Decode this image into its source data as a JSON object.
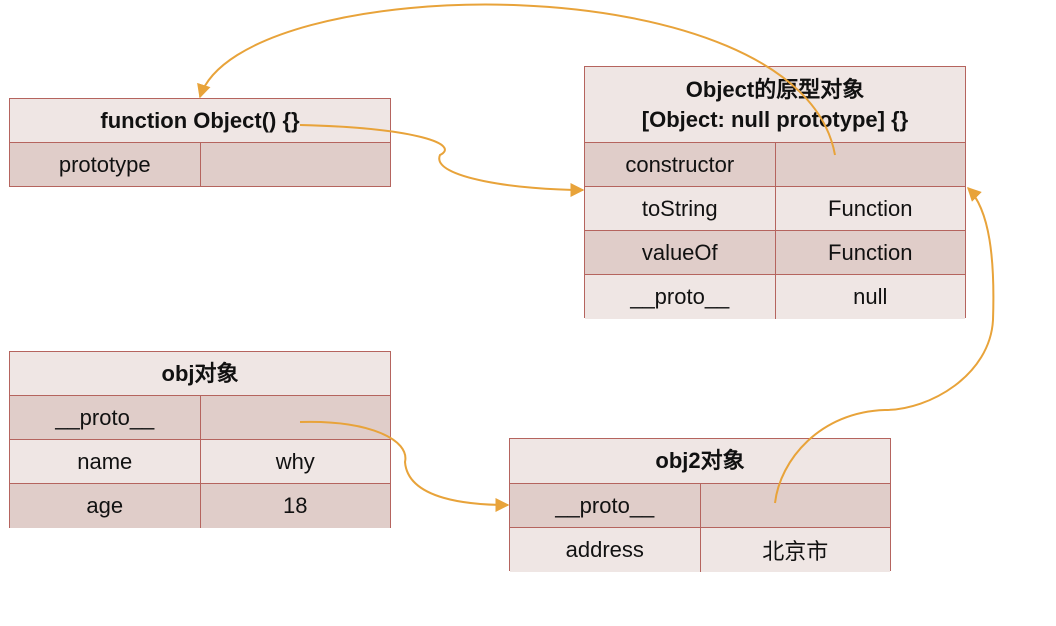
{
  "tables": {
    "object_fn": {
      "header": [
        "function Object() {}"
      ],
      "rows": [
        [
          "prototype",
          ""
        ]
      ]
    },
    "object_proto": {
      "header": [
        "Object的原型对象",
        "[Object: null prototype] {}"
      ],
      "rows": [
        [
          "constructor",
          ""
        ],
        [
          "toString",
          "Function"
        ],
        [
          "valueOf",
          "Function"
        ],
        [
          "__proto__",
          "null"
        ]
      ]
    },
    "obj": {
      "header": [
        "obj对象"
      ],
      "rows": [
        [
          "__proto__",
          ""
        ],
        [
          "name",
          "why"
        ],
        [
          "age",
          "18"
        ]
      ]
    },
    "obj2": {
      "header": [
        "obj2对象"
      ],
      "rows": [
        [
          "__proto__",
          ""
        ],
        [
          "address",
          "北京市"
        ]
      ]
    }
  },
  "colors": {
    "arrow": "#e8a33a",
    "border": "#b5645e",
    "row_dark": "#e0cdc9",
    "row_light": "#efe6e4"
  }
}
